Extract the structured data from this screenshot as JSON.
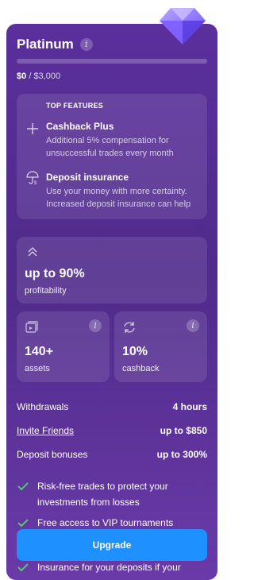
{
  "plan": {
    "name": "Platinum",
    "info_symbol": "i",
    "progress": {
      "current": "$0",
      "separator": "/",
      "target": "$3,000",
      "fraction": 0.0
    }
  },
  "top_features": {
    "heading": "TOP FEATURES",
    "items": [
      {
        "title": "Cashback Plus",
        "icon": "plus-icon",
        "desc_lines": [
          "Additional 5% compensation for",
          "unsuccessful trades every month"
        ]
      },
      {
        "title": "Deposit insurance",
        "icon": "umbrella-dollar-icon",
        "desc_lines": [
          "Use your money with more certainty.",
          "Increased deposit insurance can help"
        ]
      }
    ]
  },
  "stats": {
    "profitability": {
      "value": "up to 90%",
      "label": "profitability",
      "icon": "double-chevron-up-icon"
    },
    "assets": {
      "value": "140+",
      "label": "assets",
      "icon": "assets-icon"
    },
    "cashback": {
      "value": "10%",
      "label": "cashback",
      "icon": "refresh-icon"
    }
  },
  "details": [
    {
      "label": "Withdrawals",
      "value": "4 hours",
      "link": false
    },
    {
      "label": "Invite Friends",
      "value": "up to $850",
      "link": true
    },
    {
      "label": "Deposit bonuses",
      "value": "up to 300%",
      "link": false
    }
  ],
  "benefits": [
    {
      "text_lines": [
        "Risk-free trades to protect your",
        "investments from losses"
      ]
    },
    {
      "text_lines": [
        "Free access to VIP tournaments"
      ]
    },
    {
      "text_lines": [
        "Insurance for your deposits if your"
      ]
    }
  ],
  "upgrade_label": "Upgrade",
  "colors": {
    "card_top": "#5b2f9c",
    "card_bottom": "#6a3aa8",
    "button": "#1e90ff",
    "check": "#4cd964"
  }
}
